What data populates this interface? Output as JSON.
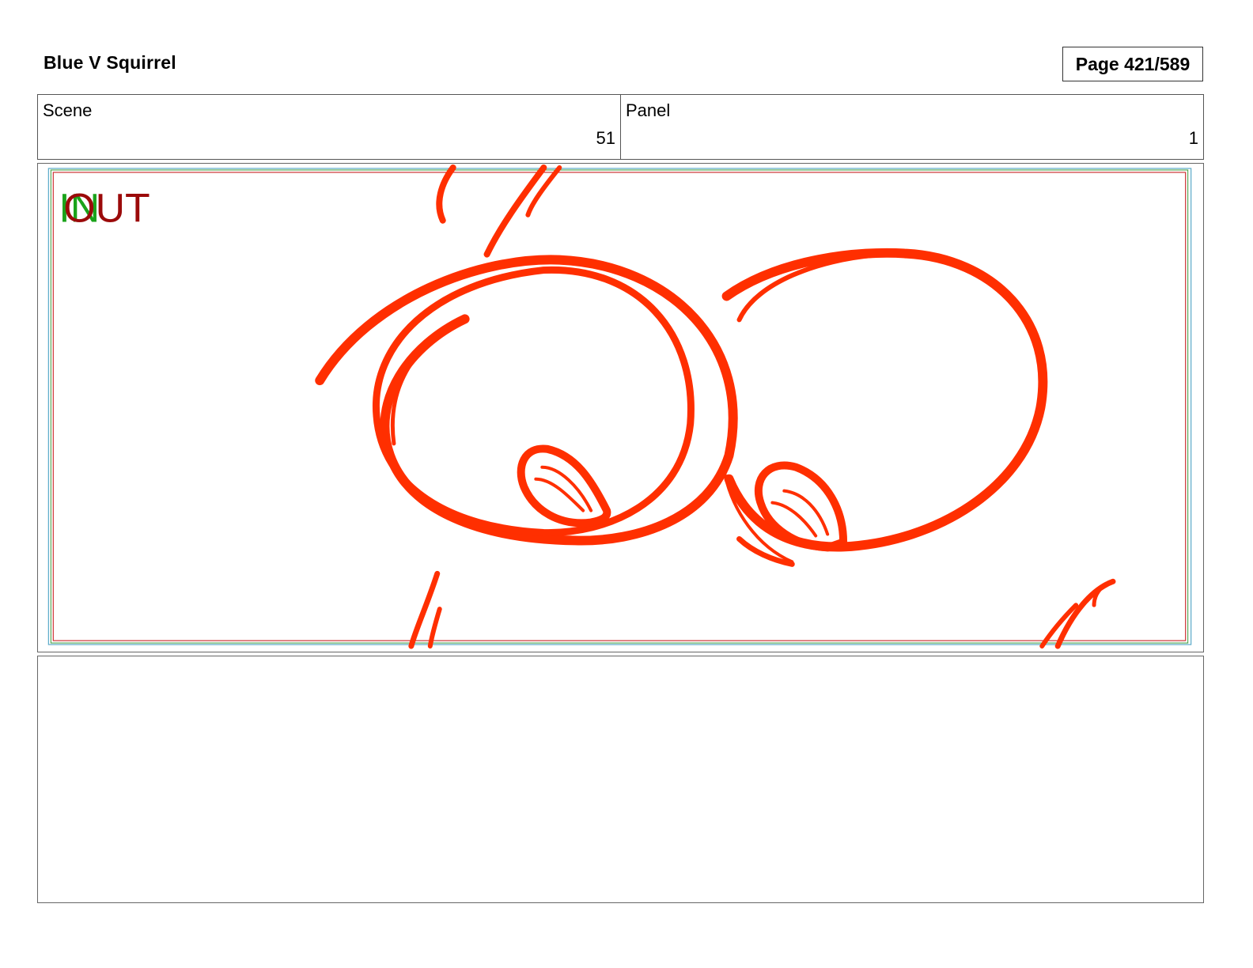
{
  "document": {
    "title": "Blue V Squirrel",
    "page": "Page 421/589"
  },
  "info": {
    "scene_label": "Scene",
    "scene_value": "51",
    "panel_label": "Panel",
    "panel_value": "1"
  },
  "panel": {
    "in_marker": "IN",
    "out_marker": "OUT",
    "colors": {
      "sketch": "#ff2f00",
      "in_marker": "#1aa31a",
      "out_marker": "#9b0a0a",
      "safe_frame_red": "#cc3333",
      "safe_frame_green": "#3a9a3a",
      "safe_frame_blue": "#5aa9c9"
    }
  },
  "notes": {
    "text": ""
  }
}
